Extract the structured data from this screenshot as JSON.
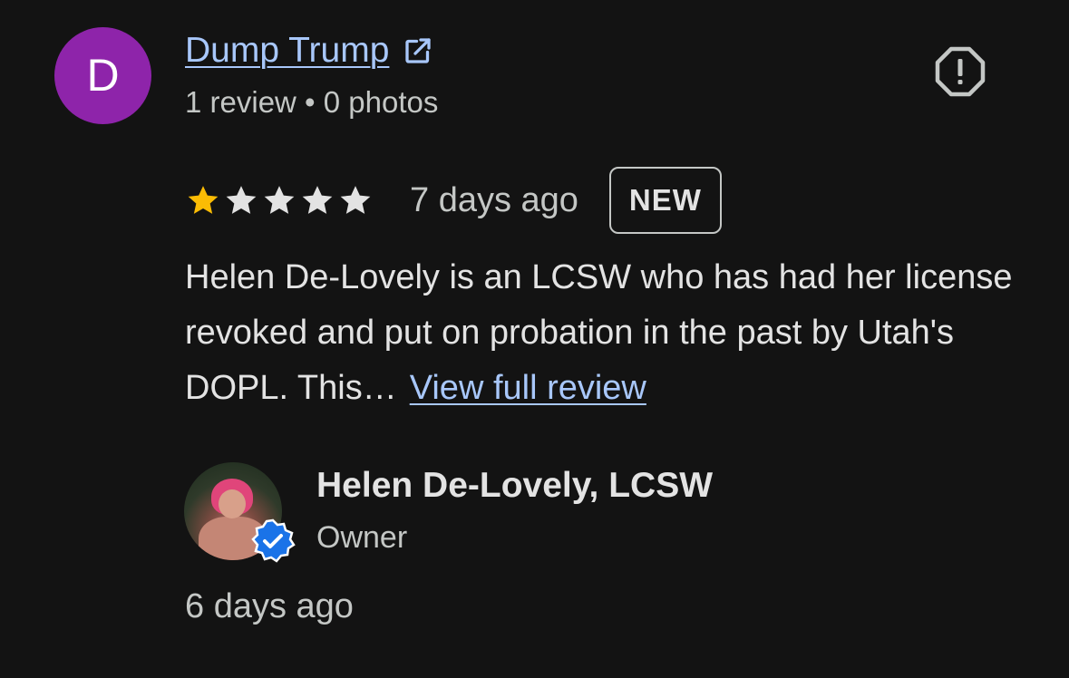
{
  "reviewer": {
    "avatar_letter": "D",
    "name": "Dump Trump",
    "meta": "1 review • 0 photos"
  },
  "review": {
    "rating": 1,
    "max_rating": 5,
    "date": "7 days ago",
    "badge": "NEW",
    "text": "Helen De-Lovely is an LCSW who has had her license revoked and put on probation in the past by Utah's DOPL. This…",
    "view_full_label": "View full review"
  },
  "owner_response": {
    "name": "Helen De-Lovely, LCSW",
    "role": "Owner",
    "date": "6 days ago"
  },
  "colors": {
    "background": "#131313",
    "avatar": "#8e24aa",
    "link": "#a8c7fa",
    "star_filled": "#fbbc04",
    "star_empty": "#e3e3e3",
    "verified": "#1a73e8"
  },
  "icons": [
    "external-link-icon",
    "report-icon",
    "star-icon",
    "verified-badge-icon"
  ]
}
